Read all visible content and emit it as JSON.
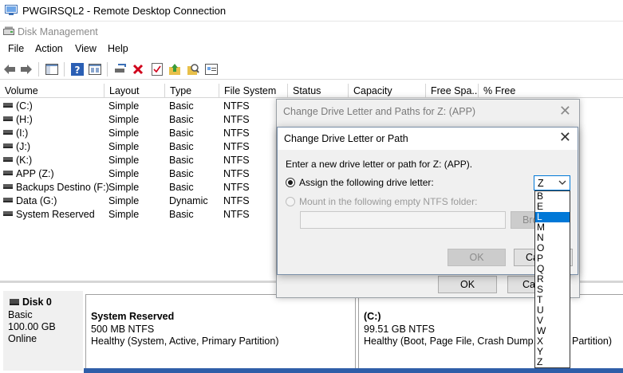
{
  "rdp": {
    "title": "PWGIRSQL2 - Remote Desktop Connection"
  },
  "app": {
    "title": "Disk Management"
  },
  "menu": [
    "File",
    "Action",
    "View",
    "Help"
  ],
  "toolbar_icons": [
    "back-arrow-icon",
    "forward-arrow-icon",
    "console-tree-icon",
    "help-icon",
    "properties-icon",
    "connect-drive-icon",
    "delete-icon",
    "checklist-icon",
    "up-folder-icon",
    "search-icon",
    "settings-panel-icon"
  ],
  "columns": [
    "Volume",
    "Layout",
    "Type",
    "File System",
    "Status",
    "Capacity",
    "Free Spa...",
    "% Free"
  ],
  "volumes": [
    {
      "name": "(C:)",
      "layout": "Simple",
      "type": "Basic",
      "fs": "NTFS"
    },
    {
      "name": "(H:)",
      "layout": "Simple",
      "type": "Basic",
      "fs": "NTFS"
    },
    {
      "name": "(I:)",
      "layout": "Simple",
      "type": "Basic",
      "fs": "NTFS"
    },
    {
      "name": "(J:)",
      "layout": "Simple",
      "type": "Basic",
      "fs": "NTFS"
    },
    {
      "name": "(K:)",
      "layout": "Simple",
      "type": "Basic",
      "fs": "NTFS"
    },
    {
      "name": "APP (Z:)",
      "layout": "Simple",
      "type": "Basic",
      "fs": "NTFS"
    },
    {
      "name": "Backups Destino (F:)",
      "layout": "Simple",
      "type": "Basic",
      "fs": "NTFS"
    },
    {
      "name": "Data (G:)",
      "layout": "Simple",
      "type": "Dynamic",
      "fs": "NTFS"
    },
    {
      "name": "System Reserved",
      "layout": "Simple",
      "type": "Basic",
      "fs": "NTFS"
    }
  ],
  "disk0": {
    "name": "Disk 0",
    "type": "Basic",
    "size": "100.00 GB",
    "status": "Online"
  },
  "partitions": [
    {
      "name": "System Reserved",
      "size": "500 MB NTFS",
      "status": "Healthy (System, Active, Primary Partition)"
    },
    {
      "name": "(C:)",
      "size": "99.51 GB NTFS",
      "status": "Healthy (Boot, Page File, Crash Dump, Pr"
    }
  ],
  "partitions_tail": "Partition)",
  "dialog_back": {
    "title": "Change Drive Letter and Paths for Z: (APP)",
    "ok": "OK",
    "cancel": "Ca"
  },
  "dialog_front": {
    "title": "Change Drive Letter or Path",
    "prompt": "Enter a new drive letter or path for Z: (APP).",
    "assign_label": "Assign the following drive letter:",
    "mount_label": "Mount in the following empty NTFS folder:",
    "browse": "Bro",
    "ok": "OK",
    "cancel": "Ca",
    "selected_letter": "Z"
  },
  "drive_letters": [
    "B",
    "E",
    "L",
    "M",
    "N",
    "O",
    "P",
    "Q",
    "R",
    "S",
    "T",
    "U",
    "V",
    "W",
    "X",
    "Y",
    "Z"
  ],
  "highlighted_letter": "L"
}
